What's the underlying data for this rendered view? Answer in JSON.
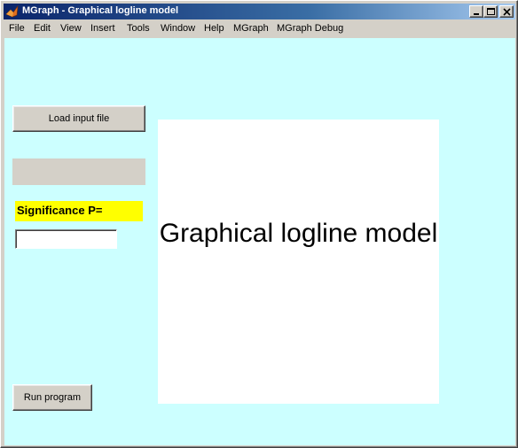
{
  "window": {
    "title": "MGraph - Graphical logline model"
  },
  "menu": [
    "File",
    "Edit",
    "View",
    "Insert",
    "Tools",
    "Window",
    "Help",
    "MGraph",
    "MGraph Debug"
  ],
  "buttons": {
    "load": "Load input file",
    "run": "Run program"
  },
  "significance": {
    "label": "Significance P=",
    "value": ""
  },
  "plot": {
    "text": "Graphical logline model"
  },
  "colors": {
    "client_bg": "#ccffff",
    "label_bg": "#ffff00",
    "titlebar": "#0a246a"
  }
}
